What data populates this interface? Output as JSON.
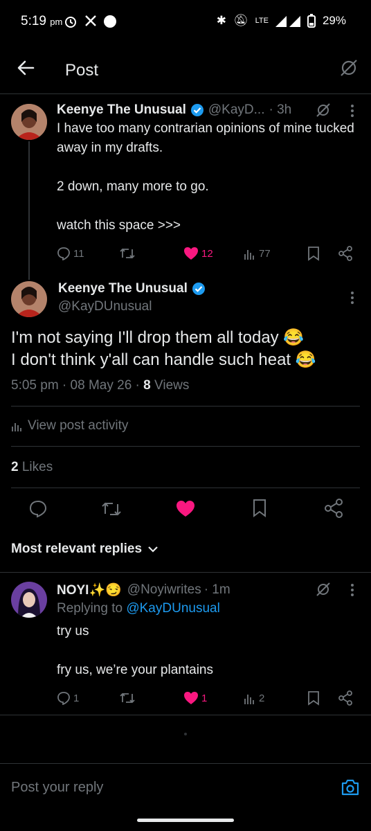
{
  "status_bar": {
    "time": "5:19",
    "ampm": "pm",
    "battery": "29%",
    "network": "LTE"
  },
  "header": {
    "title": "Post"
  },
  "parent_post": {
    "name": "Keenye The Unusual",
    "handle": "@KayD...",
    "age": "· 3h",
    "text": "I have too many contrarian opinions of mine tucked away in my drafts.\n\n2 down, many more to go.\n\nwatch this space >>>",
    "replies": "11",
    "likes": "12",
    "views": "77"
  },
  "main_post": {
    "name": "Keenye The Unusual",
    "handle": "@KayDUnusual",
    "line1": "I'm not saying I'll drop them all today 😂",
    "line2": "I don't think y'all can handle such heat 😂",
    "timestamp": "5:05 pm · 08 May 26 · ",
    "views_count": "8",
    "views_label": " Views",
    "activity_label": "View post activity",
    "likes_count": "2",
    "likes_label": " Likes"
  },
  "replies_section": {
    "sort_label": "Most relevant replies"
  },
  "reply": {
    "name": "NOYI✨😏",
    "handle": "@Noyiwrites",
    "age": "· 1m",
    "replying_prefix": "Replying to ",
    "replying_to": "@KayDUnusual",
    "text": "try us\n\nfry us, we’re your plantains",
    "replies": "1",
    "likes": "1",
    "views": "2"
  },
  "composer": {
    "placeholder": "Post your reply"
  },
  "colors": {
    "background": "#000000",
    "accent": "#1d9bf0",
    "like": "#f91880",
    "muted": "#71767b",
    "divider": "#2f3336"
  },
  "icons": [
    "back-arrow-icon",
    "grok-icon",
    "verified-icon",
    "more-icon",
    "reply-icon",
    "repost-icon",
    "heart-icon",
    "views-icon",
    "bookmark-icon",
    "share-icon",
    "camera-icon",
    "chevron-down-icon"
  ]
}
